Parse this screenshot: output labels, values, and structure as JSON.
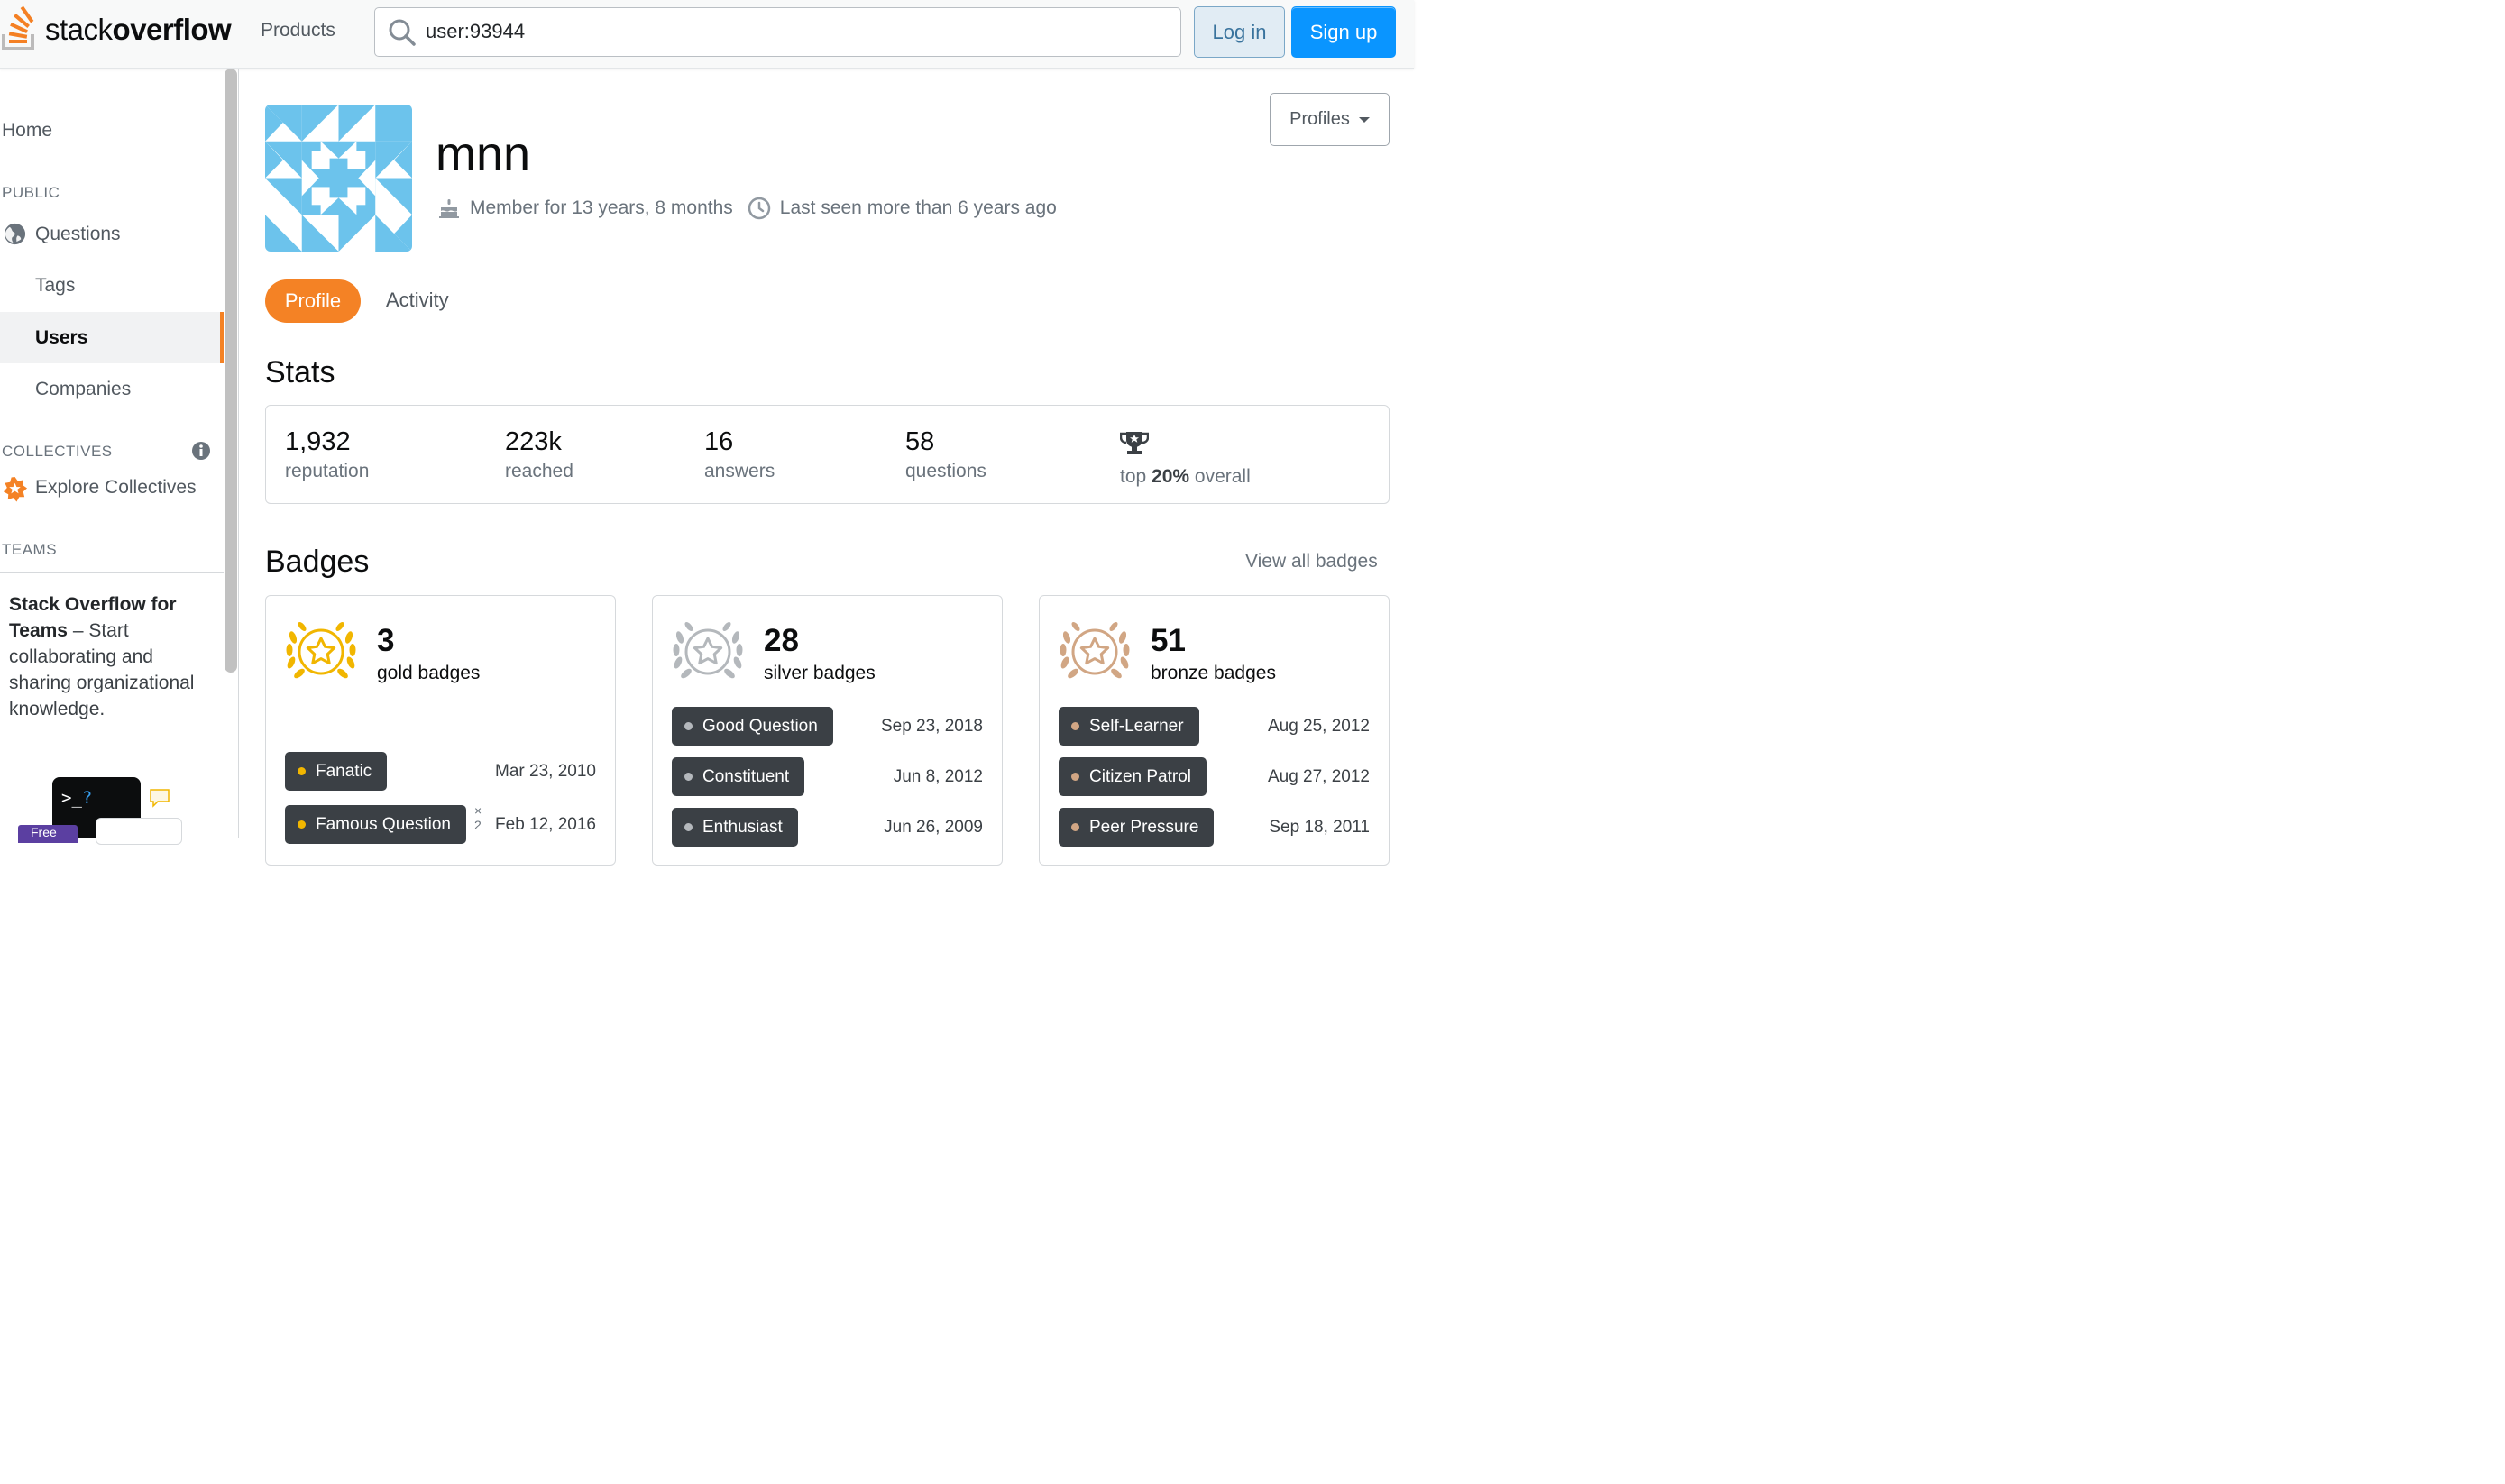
{
  "header": {
    "logo_stack": "stack",
    "logo_overflow": "overflow",
    "products_label": "Products",
    "search_value": "user:93944",
    "login_label": "Log in",
    "signup_label": "Sign up"
  },
  "sidebar": {
    "home": "Home",
    "public_heading": "PUBLIC",
    "questions": "Questions",
    "tags": "Tags",
    "users": "Users",
    "companies": "Companies",
    "collectives_heading": "COLLECTIVES",
    "explore_collectives": "Explore Collectives",
    "teams_heading": "TEAMS",
    "teams_bold": "Stack Overflow for Teams",
    "teams_text": " – Start collaborating and sharing organizational knowledge.",
    "teams_badge": "Free"
  },
  "profile": {
    "username": "mnn",
    "member_for": "Member for 13 years, 8 months",
    "last_seen": "Last seen more than 6 years ago",
    "profiles_button": "Profiles",
    "tab_profile": "Profile",
    "tab_activity": "Activity"
  },
  "stats": {
    "heading": "Stats",
    "reputation_value": "1,932",
    "reputation_label": "reputation",
    "reached_value": "223k",
    "reached_label": "reached",
    "answers_value": "16",
    "answers_label": "answers",
    "questions_value": "58",
    "questions_label": "questions",
    "top_prefix": "top ",
    "top_percent": "20%",
    "top_suffix": " overall"
  },
  "badges": {
    "heading": "Badges",
    "view_all": "View all badges",
    "colors": {
      "gold": "#f1b600",
      "silver": "#b4b8bc",
      "bronze": "#d1a684"
    },
    "gold": {
      "count": "3",
      "label": "gold badges",
      "items": [
        {
          "name": "Fanatic",
          "date": "Mar 23, 2010"
        },
        {
          "name": "Famous Question",
          "date": "Feb 12, 2016",
          "mult_x": "×",
          "mult_n": "2"
        }
      ]
    },
    "silver": {
      "count": "28",
      "label": "silver badges",
      "items": [
        {
          "name": "Good Question",
          "date": "Sep 23, 2018"
        },
        {
          "name": "Constituent",
          "date": "Jun 8, 2012"
        },
        {
          "name": "Enthusiast",
          "date": "Jun 26, 2009"
        }
      ]
    },
    "bronze": {
      "count": "51",
      "label": "bronze badges",
      "items": [
        {
          "name": "Self-Learner",
          "date": "Aug 25, 2012"
        },
        {
          "name": "Citizen Patrol",
          "date": "Aug 27, 2012"
        },
        {
          "name": "Peer Pressure",
          "date": "Sep 18, 2011"
        }
      ]
    }
  }
}
